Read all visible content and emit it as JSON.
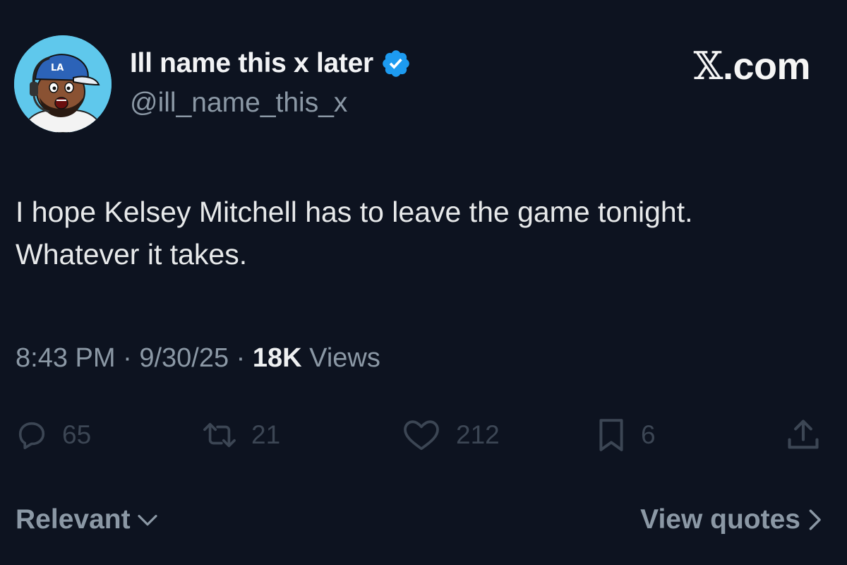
{
  "author": {
    "display_name": "Ill name this x later",
    "handle": "@ill_name_this_x",
    "avatar_icon": "cartoon-avatar-with-headset-and-cap",
    "verified": true
  },
  "source": {
    "x_symbol": "𝕏",
    "suffix": ".com"
  },
  "tweet": {
    "text": "I hope Kelsey Mitchell has to leave the game tonight. Whatever it takes."
  },
  "meta": {
    "time": "8:43 PM",
    "separator": "·",
    "date": "9/30/25",
    "views_count": "18K",
    "views_label": "Views"
  },
  "actions": {
    "replies": "65",
    "reposts": "21",
    "likes": "212",
    "bookmarks": "6"
  },
  "footer": {
    "sort_label": "Relevant",
    "quotes_label": "View quotes"
  },
  "colors": {
    "background": "#0d1320",
    "primary_text": "#e7e9ea",
    "secondary_text": "#8b98a5",
    "action_icon": "#3c4654",
    "verified_badge": "#1d9bf0",
    "avatar_bg": "#5fc8ec"
  }
}
